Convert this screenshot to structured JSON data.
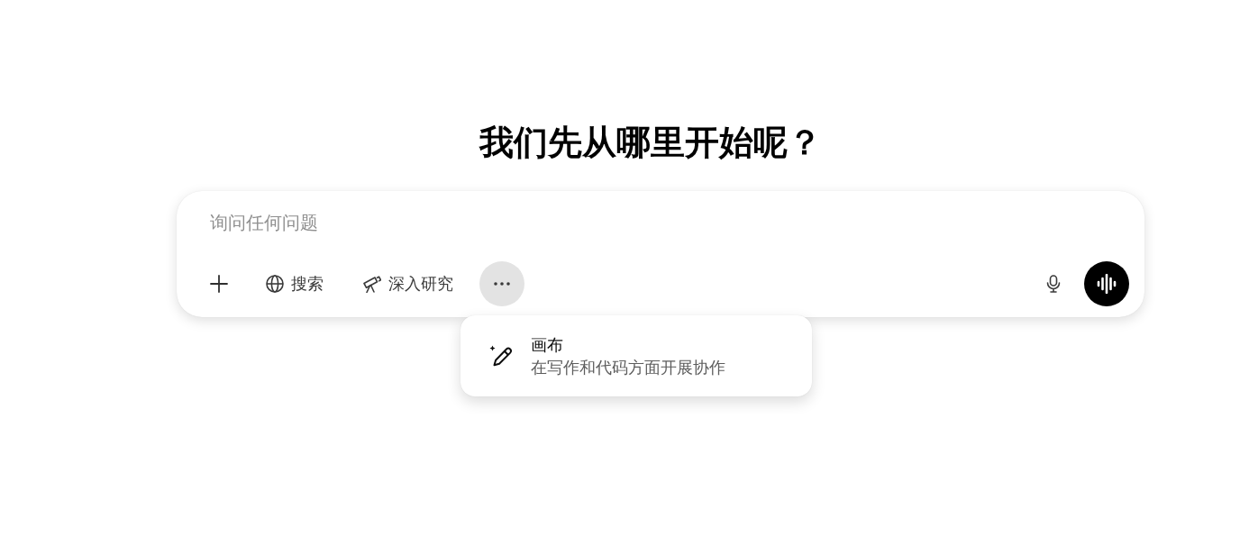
{
  "heading": "我们先从哪里开始呢？",
  "composer": {
    "placeholder": "询问任何问题",
    "tools": [
      {
        "kind": "add"
      },
      {
        "kind": "search",
        "label": "搜索"
      },
      {
        "kind": "research",
        "label": "深入研究"
      },
      {
        "kind": "more",
        "expanded": true
      }
    ],
    "actions": [
      {
        "kind": "dictate"
      },
      {
        "kind": "voice"
      }
    ]
  },
  "menu": {
    "items": [
      {
        "kind": "canvas",
        "title": "画布",
        "description": "在写作和代码方面开展协作"
      }
    ]
  }
}
